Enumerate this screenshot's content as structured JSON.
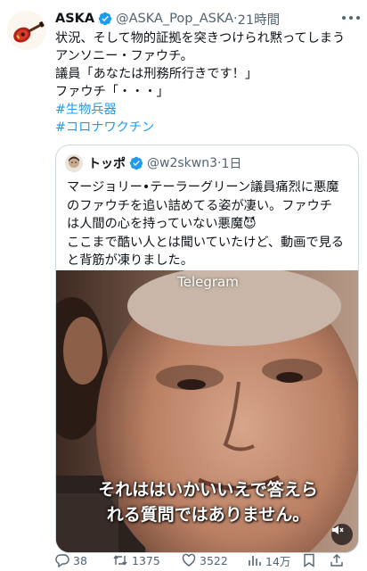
{
  "tweet": {
    "display_name": "ASKA",
    "handle": "@ASKA_Pop_ASKA",
    "separator": "·",
    "time": "21時間",
    "lines": [
      "状況、そして物的証拠を突きつけられ黙ってしまう",
      "アンソニー・ファウチ。",
      "議員「あなたは刑務所行きです！」",
      "ファウチ「・・・」"
    ],
    "hashtags": [
      "#生物兵器",
      "#コロナワクチン"
    ]
  },
  "quote": {
    "display_name": "トッポ",
    "handle": "@w2skwn3",
    "separator": "·",
    "time": "1日",
    "lines": [
      "マージョリー•テーラーグリーン議員痛烈に悪魔",
      "のファウチを追い詰めてる姿が凄い。ファウチ",
      "は人間の心を持っていない悪魔😈",
      "ここまで酷い人とは聞いていたけど、動画で見る",
      "と背筋が凍りました。"
    ],
    "media": {
      "watermark": "Telegram",
      "subtitle_lines": [
        "それははいかいいえで答えら",
        "れる質問ではありません。"
      ]
    }
  },
  "actions": {
    "replies": "38",
    "retweets": "1375",
    "likes": "3522",
    "views": "14万"
  },
  "colors": {
    "accent": "#1d9bf0",
    "secondary_text": "#536471",
    "border": "#cfd9de"
  },
  "icons": [
    "guitar-avatar-icon",
    "verified-badge-icon",
    "more-icon",
    "reply-icon",
    "retweet-icon",
    "like-icon",
    "views-icon",
    "bookmark-icon",
    "share-icon",
    "mute-icon"
  ]
}
